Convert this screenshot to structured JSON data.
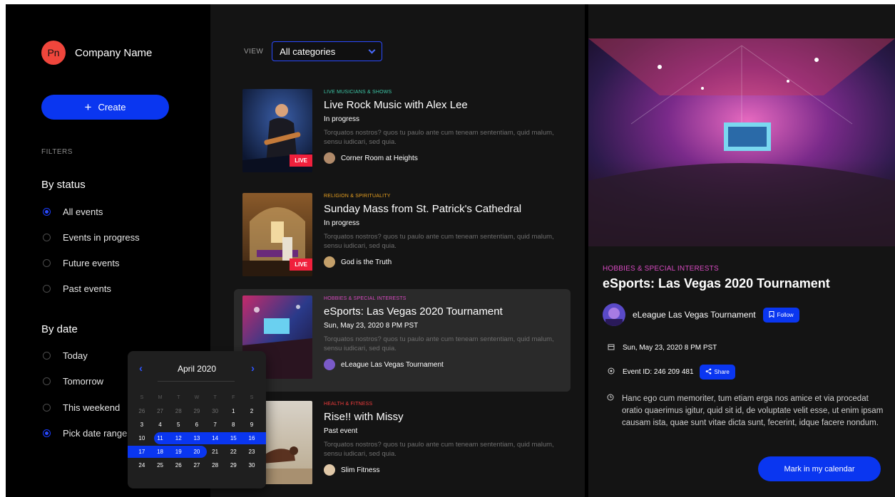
{
  "sidebar": {
    "avatar_initials": "Pn",
    "company_name": "Company Name",
    "create_label": "Create",
    "filters_label": "FILTERS",
    "status_title": "By status",
    "status_options": [
      "All events",
      "Events in progress",
      "Future events",
      "Past events"
    ],
    "date_title": "By date",
    "date_options": [
      "Today",
      "Tomorrow",
      "This weekend",
      "Pick date range"
    ]
  },
  "calendar": {
    "month": "April 2020",
    "weekdays": [
      "S",
      "M",
      "T",
      "W",
      "T",
      "F",
      "S"
    ],
    "weeks": [
      [
        "26",
        "27",
        "28",
        "29",
        "30",
        "1",
        "2"
      ],
      [
        "3",
        "4",
        "5",
        "6",
        "7",
        "8",
        "9"
      ],
      [
        "10",
        "11",
        "12",
        "13",
        "14",
        "15",
        "16"
      ],
      [
        "17",
        "18",
        "19",
        "20",
        "21",
        "22",
        "23"
      ],
      [
        "24",
        "25",
        "26",
        "27",
        "28",
        "29",
        "30"
      ]
    ],
    "dim_in_first_week": 5,
    "selected_range": [
      "11",
      "20"
    ]
  },
  "view": {
    "label": "VIEW",
    "selected": "All categories"
  },
  "events": [
    {
      "category": "LIVE MUSICIANS & SHOWS",
      "category_color": "#3ec8a8",
      "title": "Live Rock Music with Alex Lee",
      "when": "In progress",
      "description": "Torquatos nostros? quos tu paulo ante cum teneam sententiam, quid malum, sensu iudicari, sed quia.",
      "host": "Corner Room at Heights",
      "badge": "LIVE"
    },
    {
      "category": "RELIGION & SPIRITUALITY",
      "category_color": "#e8a020",
      "title": "Sunday Mass from St. Patrick's Cathedral",
      "when": "In progress",
      "description": "Torquatos nostros? quos tu paulo ante cum teneam sententiam, quid malum, sensu iudicari, sed quia.",
      "host": "God is the Truth",
      "badge": "LIVE"
    },
    {
      "category": "HOBBIES & SPECIAL INTERESTS",
      "category_color": "#d74ac0",
      "title": "eSports: Las Vegas 2020 Tournament",
      "when": "Sun, May 23, 2020 8 PM PST",
      "description": "Torquatos nostros? quos tu paulo ante cum teneam sententiam, quid malum, sensu iudicari, sed quia.",
      "host": "eLeague Las Vegas Tournament",
      "badge": ""
    },
    {
      "category": "HEALTH & FITNESS",
      "category_color": "#f03c3c",
      "title": "Rise!! with Missy",
      "when": "Past event",
      "description": "Torquatos nostros? quos tu paulo ante cum teneam sententiam, quid malum, sensu iudicari, sed quia.",
      "host": "Slim Fitness",
      "badge": ""
    }
  ],
  "detail": {
    "category": "HOBBIES & SPECIAL INTERESTS",
    "title": "eSports: Las Vegas 2020 Tournament",
    "host": "eLeague Las Vegas Tournament",
    "follow_label": "Follow",
    "date": "Sun, May 23, 2020 8 PM PST",
    "event_id": "Event ID: 246 209 481",
    "share_label": "Share",
    "description": "Hanc ego cum memoriter, tum etiam erga nos amice et via procedat oratio quaerimus igitur, quid sit id, de voluptate velit esse, ut enim ipsam causam ista, quae sunt vitae dicta sunt, fecerint, idque facere nondum.",
    "calendar_button": "Mark in my calendar"
  },
  "colors": {
    "accent": "#0a36f0",
    "live": "#f0203c",
    "avatar": "#f0463c"
  }
}
